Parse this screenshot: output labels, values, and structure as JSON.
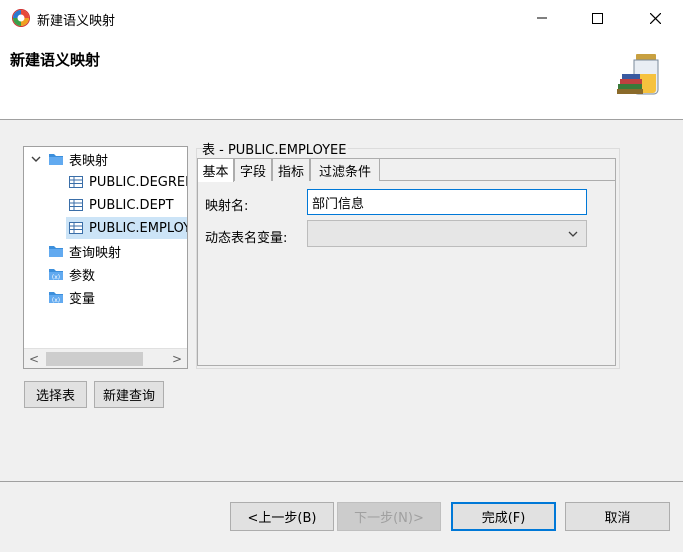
{
  "window": {
    "title": "新建语义映射",
    "controls": {
      "minimize": "–",
      "maximize": "☐",
      "close": "✕"
    }
  },
  "header": {
    "title": "新建语义映射",
    "banner_icon": "database-wizard-icon"
  },
  "tree": {
    "root_label": "表映射",
    "tables": [
      "PUBLIC.DEGREE",
      "PUBLIC.DEPT",
      "PUBLIC.EMPLOYEE"
    ],
    "selected_index": 2,
    "other_nodes": [
      "查询映射",
      "参数",
      "变量"
    ],
    "scroll_left": "<",
    "scroll_right": ">"
  },
  "buttons": {
    "select_table": "选择表",
    "new_query": "新建查询"
  },
  "group": {
    "label": "表 - PUBLIC.EMPLOYEE"
  },
  "tabs": [
    "基本",
    "字段",
    "指标",
    "过滤条件"
  ],
  "active_tab": 0,
  "form": {
    "mapping_name_label": "映射名:",
    "mapping_name_value": "部门信息",
    "dynamic_table_label": "动态表名变量:",
    "dynamic_table_value": ""
  },
  "footer": {
    "back": "<上一步(B)",
    "next": "下一步(N)>",
    "finish": "完成(F)",
    "cancel": "取消"
  },
  "colors": {
    "accent": "#0078d7",
    "selection": "#cce4f7",
    "folder": "#3c8fdc"
  }
}
